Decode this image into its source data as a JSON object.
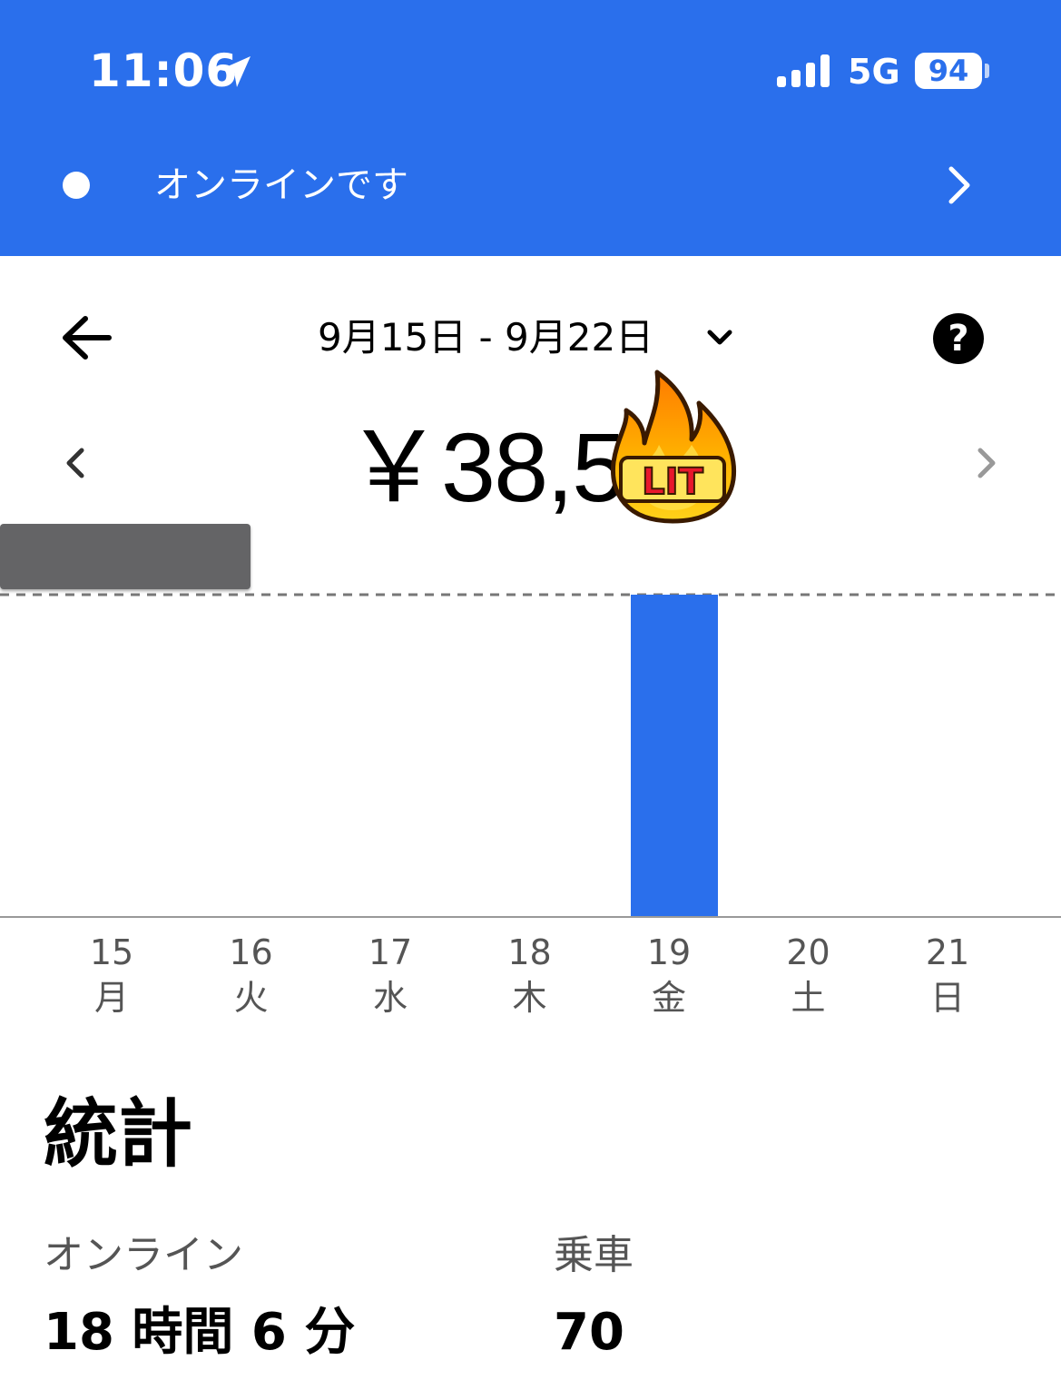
{
  "status_bar": {
    "time": "11:06",
    "network": "5G",
    "battery": "94"
  },
  "banner": {
    "label": "オンラインです"
  },
  "header": {
    "date_range": "9月15日 - 9月22日"
  },
  "earnings": {
    "amount": "￥38,5"
  },
  "sticker": {
    "text": "LIT"
  },
  "colors": {
    "accent": "#2a6fec",
    "redaction": "#646466"
  },
  "chart_data": {
    "type": "bar",
    "categories": [
      "15",
      "16",
      "17",
      "18",
      "19",
      "20",
      "21"
    ],
    "weekdays": [
      "月",
      "火",
      "水",
      "木",
      "金",
      "土",
      "日"
    ],
    "values": [
      0,
      0,
      0,
      0,
      1,
      0,
      0
    ],
    "ylim": [
      0,
      1
    ],
    "reference_line": 1,
    "grid": false,
    "title": "",
    "xlabel": "",
    "ylabel": ""
  },
  "stats": {
    "title": "統計",
    "online_label": "オンライン",
    "online_value": "18 時間 6 分",
    "rides_label": "乗車",
    "rides_value": "70"
  }
}
